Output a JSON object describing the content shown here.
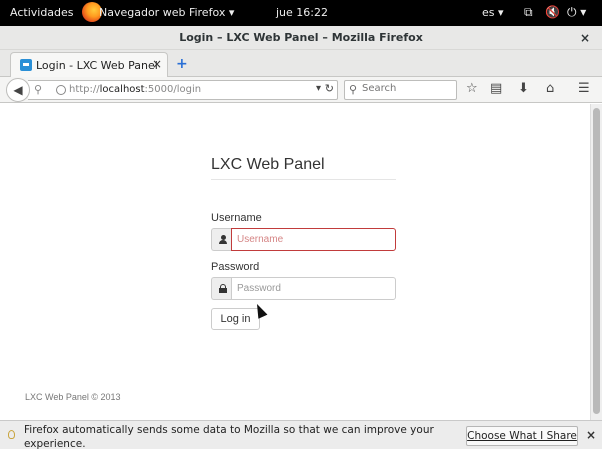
{
  "topbar": {
    "activities": "Actividades",
    "app_name": "Navegador web Firefox ▾",
    "clock": "jue 16:22",
    "language": "es ▾"
  },
  "window": {
    "title": "Login – LXC Web Panel – Mozilla Firefox",
    "close_glyph": "×"
  },
  "tabs": [
    {
      "title": "Login - LXC Web Panel",
      "close_glyph": "×"
    }
  ],
  "newtab_glyph": "+",
  "navbar": {
    "url_scheme": "http://",
    "url_host": "localhost",
    "url_rest": ":5000/login",
    "search_placeholder": "Search"
  },
  "page": {
    "heading": "LXC Web Panel",
    "username_label": "Username",
    "username_placeholder": "Username",
    "password_label": "Password",
    "password_placeholder": "Password",
    "login_button": "Log in",
    "footer": "LXC Web Panel © 2013"
  },
  "notification": {
    "message": "Firefox automatically sends some data to Mozilla so that we can improve your experience.",
    "button": "Choose What I Share",
    "close_glyph": "×"
  },
  "colors": {
    "error_border": "#c13b3b",
    "topbar_bg": "#000000"
  },
  "icons": [
    "firefox-logo",
    "network-icon",
    "volume-muted-icon",
    "power-icon",
    "back-arrow-icon",
    "identity-icon",
    "globe-icon",
    "reload-icon",
    "search-icon",
    "bookmark-star-icon",
    "reading-list-icon",
    "downloads-icon",
    "home-icon",
    "menu-icon",
    "user-icon",
    "lock-icon",
    "lightbulb-icon"
  ]
}
